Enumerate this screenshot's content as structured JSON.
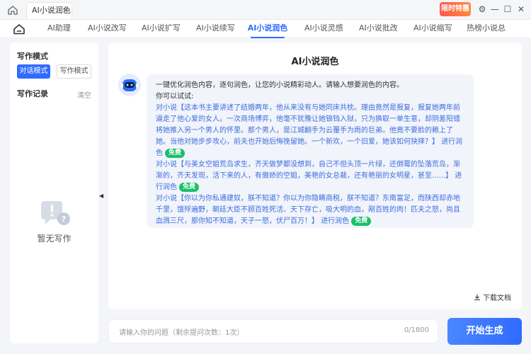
{
  "titlebar": {
    "tab_label": "AI小说润色",
    "tab_close": "×",
    "badge_text": "限时特惠",
    "controls": {
      "settings": "⚙",
      "minimize": "—",
      "maximize": "☐",
      "close": "✕"
    }
  },
  "nav": {
    "items": [
      {
        "label": "AI助理"
      },
      {
        "label": "AI小说改写"
      },
      {
        "label": "AI小说扩写"
      },
      {
        "label": "AI小说续写"
      },
      {
        "label": "AI小说润色",
        "active": true
      },
      {
        "label": "AI小说灵感"
      },
      {
        "label": "AI小说批改"
      },
      {
        "label": "AI小说缩写"
      },
      {
        "label": "热榜小说总"
      }
    ]
  },
  "sidebar": {
    "mode_title": "写作模式",
    "mode_dialog": "对话模式",
    "mode_write": "写作模式",
    "records_title": "写作记录",
    "clear_label": "清空",
    "empty_text": "暂无写作"
  },
  "main": {
    "title": "AI小说润色",
    "intro": "一键优化润色内容，逐句润色，让您的小说精彩动人。请输入想要润色的内容。",
    "try_label": "你可以试试:",
    "examples": [
      {
        "text": "对小说【这本书主要讲述了结婚两年，他从来没有与她同床共枕。理由竟然是报复，报复她两年前逼走了他心爱的女人。一次商场博弈，他毫不犹豫让她锒铛入狱，只为换取一单生意，却阴差阳错将她推入另一个男人的怀里。那个男人，是江城翻手为云覆手为雨的巨弟。他竟不要脸的赖上了她。当他对她步步攻心，前夫也开始后悔挽留她。一个新欢，一个旧爱，她该如何抉择？】",
        "action": "进行润色",
        "badge": "免费"
      },
      {
        "text": "对小说【与美女空姐荒岛求生，齐天做梦都没想到，自己不但头顶一片绿，还倒霉的坠落荒岛，渐渐的，齐天发现，活下来的人，有傲娇的空姐，美艳的女总裁，还有艳丽的女明星，甚至......】",
        "action": "进行润色",
        "badge": "免费"
      },
      {
        "text": "对小说【你以为你私通建奴，朕不知道？你以为你隐瞒商税，朕不知道？东南富足，而陕西却赤地千里，饿殍遍野，朝廷大臣不顾百姓死活、天下存亡，吸大明的血，剐百姓的肉！匹夫之怒，尚且血溅三尺，那你知不知道，天子一怒，伏尸百万！】",
        "action": "进行润色",
        "badge": "免费"
      }
    ],
    "download_label": "下载文档"
  },
  "bottom": {
    "input_placeholder": "请输入你的问题（剩余提问次数：1次）",
    "char_count": "0/1800",
    "start_label": "开始生成"
  },
  "colors": {
    "accent": "#2f6bff",
    "free_badge": "#19c167",
    "link": "#3d6de0"
  }
}
